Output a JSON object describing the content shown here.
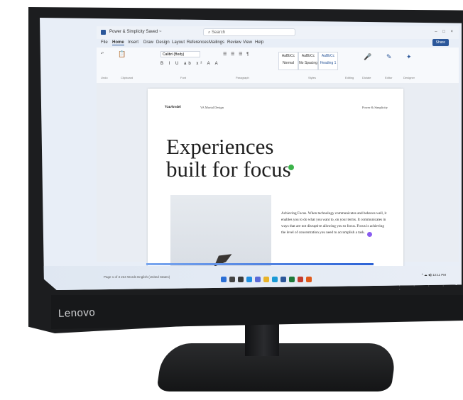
{
  "monitor": {
    "brand": "Lenovo"
  },
  "word": {
    "doc_title": "Power & Simplicity  Saved ~",
    "search_placeholder": "Search",
    "window_controls": "–  □  ×",
    "menu": [
      "File",
      "Home",
      "Insert",
      "Draw",
      "Design",
      "Layout",
      "References",
      "Mailings",
      "Review",
      "View",
      "Help"
    ],
    "share_label": "Share",
    "ribbon": {
      "font_name": "Calibri (Body)",
      "format_buttons": "B I U ab x² A A",
      "styles": [
        "AaBbCc",
        "AaBbCc",
        "AaBbCc"
      ],
      "style_names": [
        "Normal",
        "No Spacing",
        "Heading 1"
      ],
      "group_labels": [
        "Undo",
        "Clipboard",
        "Font",
        "Paragraph",
        "Styles",
        "Editing",
        "Dictate",
        "Editor",
        "Designer"
      ]
    },
    "page": {
      "brand": "VanArsdel",
      "subtitle": "VA Mortal Design",
      "header_right": "Power & Simplicity",
      "headline_line1": "Experiences",
      "headline_line2": "built for focus",
      "body": "Achieving Focus. When technology communicates and behaves well, it enables you to do what you want to, on your terms. It communicates in ways that are not disruptive allowing you to focus. Focus is achieving the level of concentration you need to accomplish a task."
    },
    "statusbar": "Page 1 of 3     234 Words     English (United States)"
  },
  "taskbar": {
    "icon_colors": [
      "#2b6fd6",
      "#444444",
      "#3a3a3a",
      "#1f8fe0",
      "#5a6ad8",
      "#e8b32a",
      "#1a9ad6",
      "#2b579a",
      "#1f7a3a",
      "#c43c2e",
      "#e05a1a"
    ],
    "tray": "^  ☁  ◀)  12:11 PM"
  }
}
